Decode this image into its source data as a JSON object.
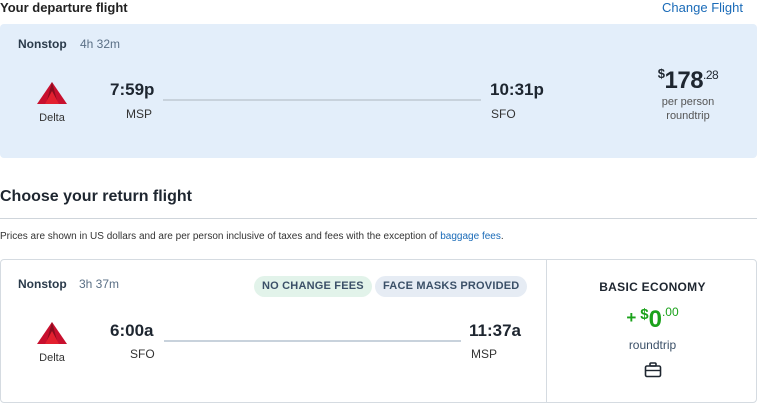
{
  "departure": {
    "heading": "Your departure flight",
    "change_link": "Change Flight",
    "stops": "Nonstop",
    "duration": "4h 32m",
    "airline": "Delta",
    "depart_time": "7:59p",
    "depart_airport": "MSP",
    "arrive_time": "10:31p",
    "arrive_airport": "SFO",
    "price_currency": "$",
    "price_whole": "178",
    "price_cents": ".28",
    "price_note_1": "per person",
    "price_note_2": "roundtrip"
  },
  "return_section": {
    "heading": "Choose your return flight",
    "disclaimer": "Prices are shown in US dollars and are per person inclusive of taxes and fees with the exception of",
    "disclaimer_link": "baggage fees",
    "disclaimer_end": "."
  },
  "return_flight": {
    "stops": "Nonstop",
    "duration": "3h 37m",
    "badges": [
      "NO CHANGE FEES",
      "FACE MASKS PROVIDED"
    ],
    "airline": "Delta",
    "depart_time": "6:00a",
    "depart_airport": "SFO",
    "arrive_time": "11:37a",
    "arrive_airport": "MSP",
    "fare_class": "BASIC ECONOMY",
    "fare_plus": "+",
    "fare_currency": "$",
    "fare_whole": "0",
    "fare_cents": ".00",
    "fare_note": "roundtrip",
    "bag_icon": "briefcase-icon"
  },
  "colors": {
    "link": "#1a6bb8",
    "departure_card_bg": "#e3eefa",
    "fare_green": "#1ba21b",
    "delta_red": "#c8102e"
  }
}
